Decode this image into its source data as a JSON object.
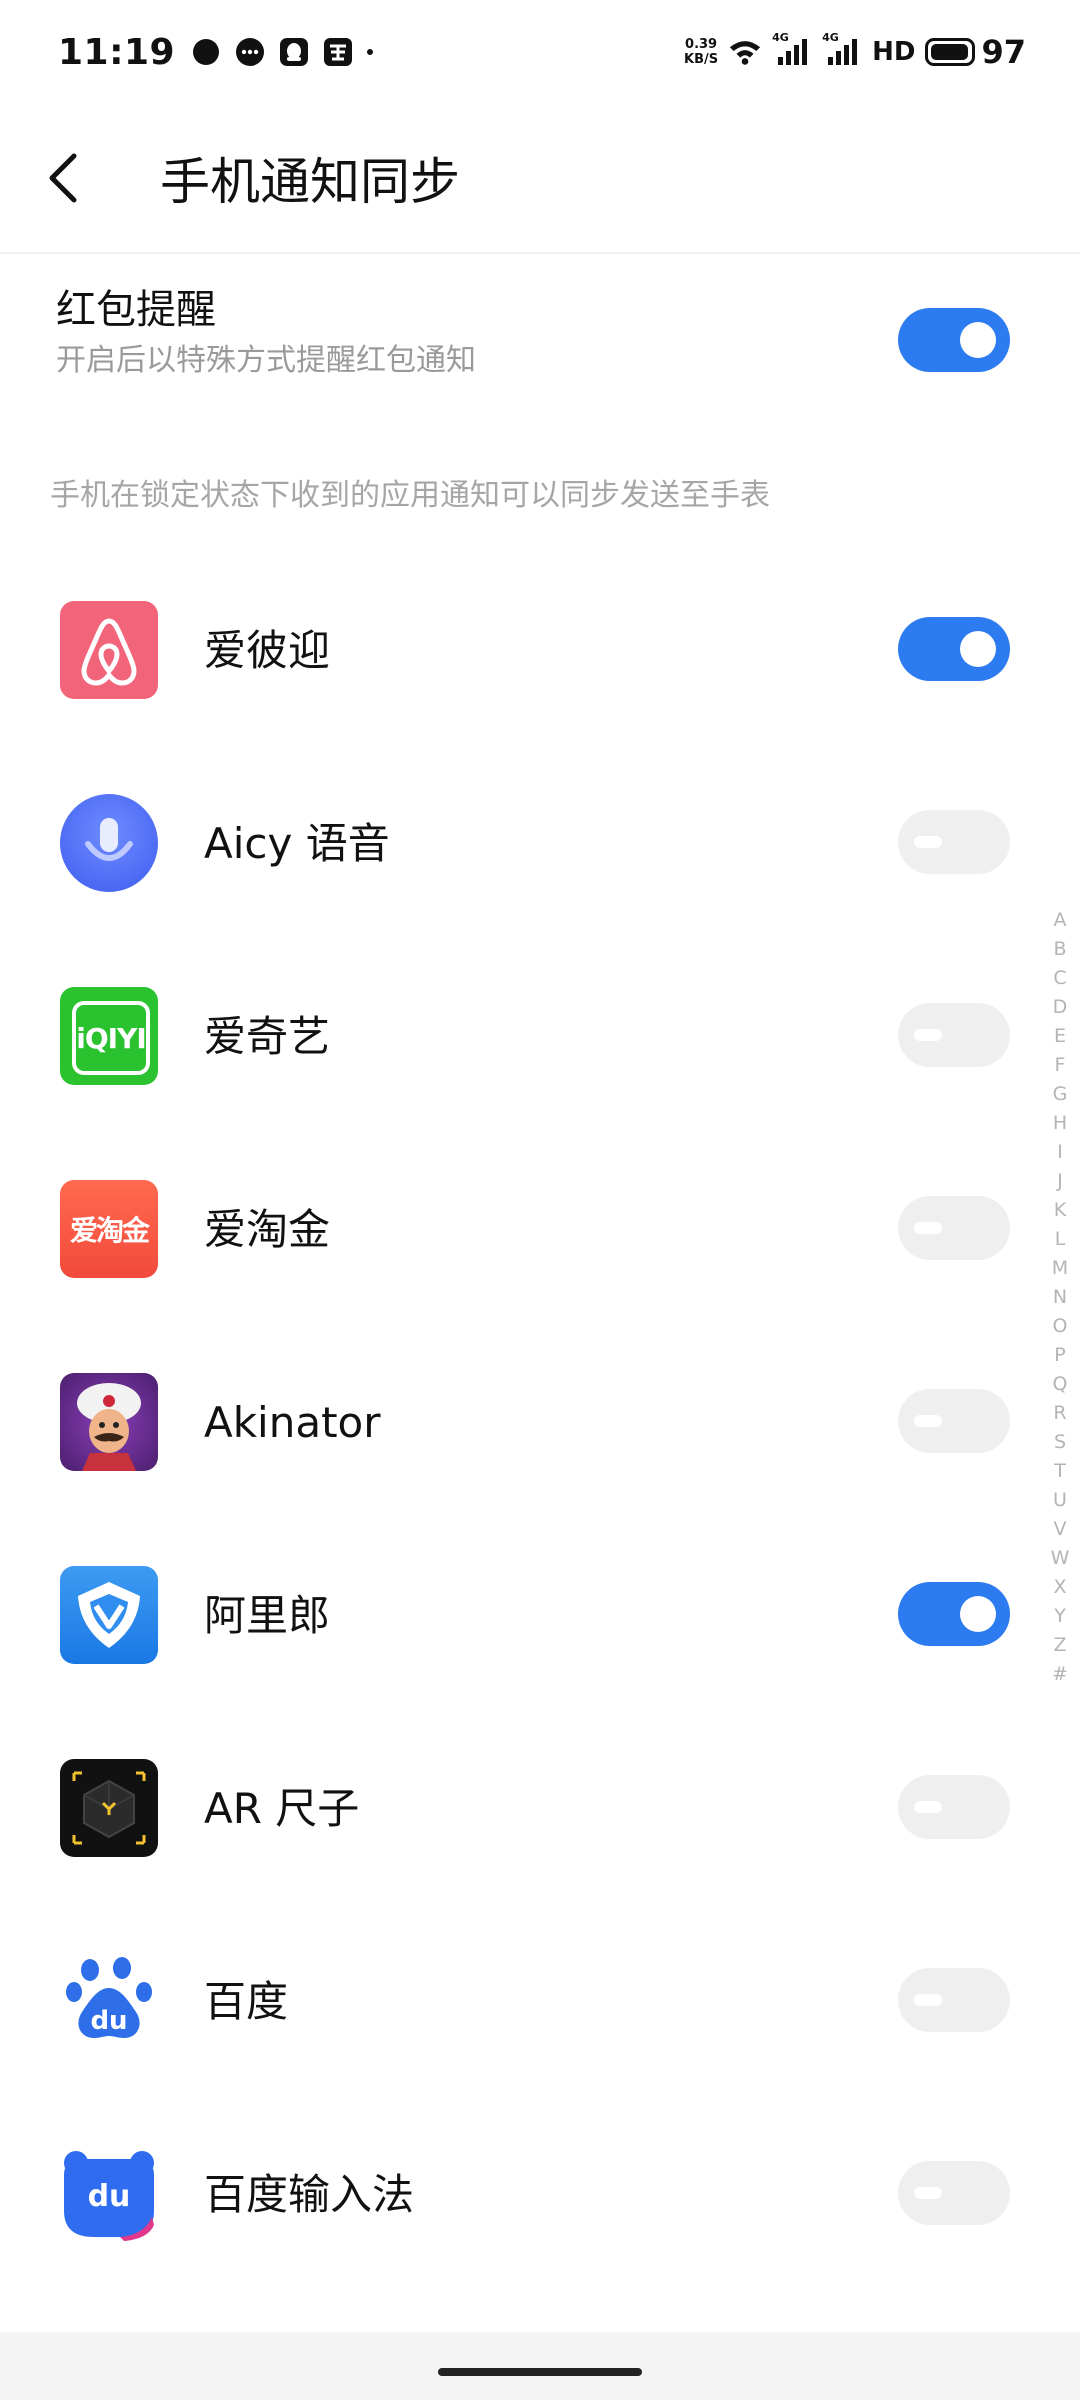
{
  "status_bar": {
    "time": "11:19",
    "net_speed_value": "0.39",
    "net_speed_unit": "KB/S",
    "sim1_label": "4G",
    "sim2_label": "4G",
    "hd_label": "HD",
    "battery": "97",
    "battery_level": 0.97
  },
  "header": {
    "title": "手机通知同步"
  },
  "red_packet": {
    "title": "红包提醒",
    "subtitle": "开启后以特殊方式提醒红包通知",
    "enabled": true
  },
  "hint": "手机在锁定状态下收到的应用通知可以同步发送至手表",
  "apps": [
    {
      "name": "爱彼迎",
      "icon": "airbnb-icon",
      "enabled": true
    },
    {
      "name": "Aicy 语音",
      "icon": "aicy-voice-icon",
      "enabled": false
    },
    {
      "name": "爱奇艺",
      "icon": "iqiyi-icon",
      "enabled": false,
      "icon_text": "iQIYI"
    },
    {
      "name": "爱淘金",
      "icon": "aitaojin-icon",
      "enabled": false,
      "icon_text": "爱淘金"
    },
    {
      "name": "Akinator",
      "icon": "akinator-icon",
      "enabled": false
    },
    {
      "name": "阿里郎",
      "icon": "alilang-icon",
      "enabled": true
    },
    {
      "name": "AR 尺子",
      "icon": "ar-ruler-icon",
      "enabled": false
    },
    {
      "name": "百度",
      "icon": "baidu-icon",
      "enabled": false,
      "icon_text": "du"
    },
    {
      "name": "百度输入法",
      "icon": "baidu-input-icon",
      "enabled": false,
      "icon_text": "du"
    }
  ],
  "alphabet": [
    "A",
    "B",
    "C",
    "D",
    "E",
    "F",
    "G",
    "H",
    "I",
    "J",
    "K",
    "L",
    "M",
    "N",
    "O",
    "P",
    "Q",
    "R",
    "S",
    "T",
    "U",
    "V",
    "W",
    "X",
    "Y",
    "Z",
    "#"
  ],
  "colors": {
    "accent": "#2d7bf0",
    "toggle_off": "#efefef",
    "muted_text": "#9a9a9a"
  }
}
